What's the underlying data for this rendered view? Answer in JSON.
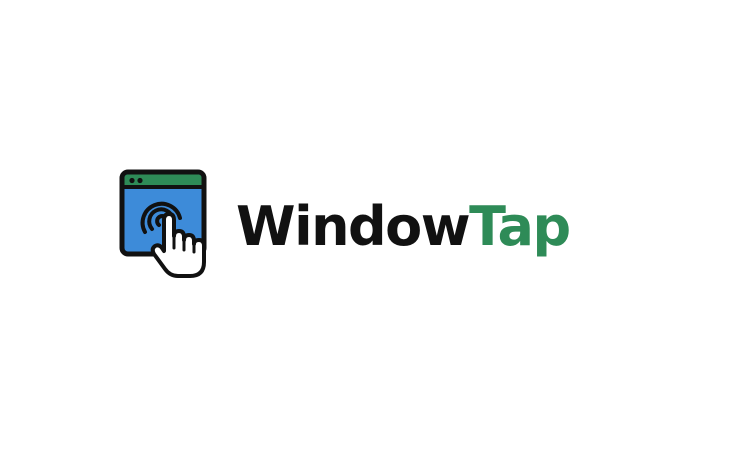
{
  "logo": {
    "wordmark_primary": "Window",
    "wordmark_accent": "Tap",
    "icon": "browser-window-tap-icon",
    "colors": {
      "primary_text": "#111111",
      "accent_text": "#2e8b57",
      "window_body": "#3d8bd9",
      "window_titlebar": "#2e8b57",
      "outline": "#111111",
      "hand": "#ffffff"
    }
  }
}
